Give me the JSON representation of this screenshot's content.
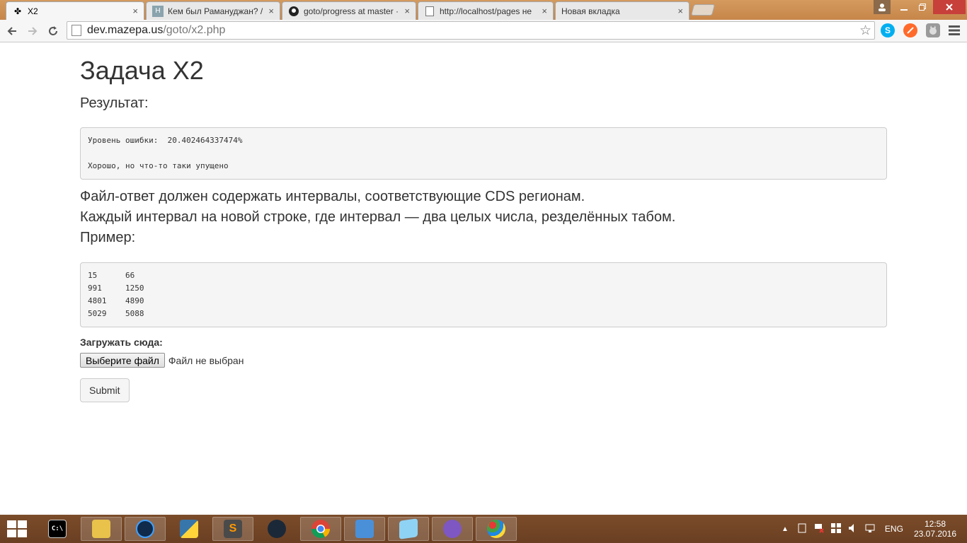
{
  "tabs": [
    {
      "label": "X2",
      "icon": "fleur-icon",
      "active": true
    },
    {
      "label": "Кем был Рамануджан? / Н",
      "icon": "habr-icon"
    },
    {
      "label": "goto/progress at master ·",
      "icon": "github-icon"
    },
    {
      "label": "http://localhost/pages не",
      "icon": "page-icon"
    },
    {
      "label": "Новая вкладка",
      "icon": ""
    }
  ],
  "tab_close": "×",
  "address": {
    "host": "dev.mazepa.us",
    "path": "/goto/x2.php"
  },
  "page": {
    "title": "Задача X2",
    "result_label": "Результат:",
    "result_text": "Уровень ошибки:  20.402464337474%\n\nХорошо, но что-то таки упущено",
    "desc_line1": "Файл-ответ должен содержать интервалы, соответствующие CDS регионам.",
    "desc_line2": "Каждый интервал на новой строке, где интервал — два целых числа, резделённых табом.",
    "example_label": "Пример:",
    "example_text": "15      66\n991     1250\n4801    4890\n5029    5088",
    "upload_label": "Загружать сюда:",
    "file_button": "Выберите файл",
    "file_status": "Файл не выбран",
    "submit": "Submit"
  },
  "tray": {
    "lang": "ENG",
    "time": "12:58",
    "date": "23.07.2016"
  },
  "colors": {
    "tabstrip": "#c7864a",
    "taskbar": "#6a3f22",
    "close": "#c7403a"
  }
}
